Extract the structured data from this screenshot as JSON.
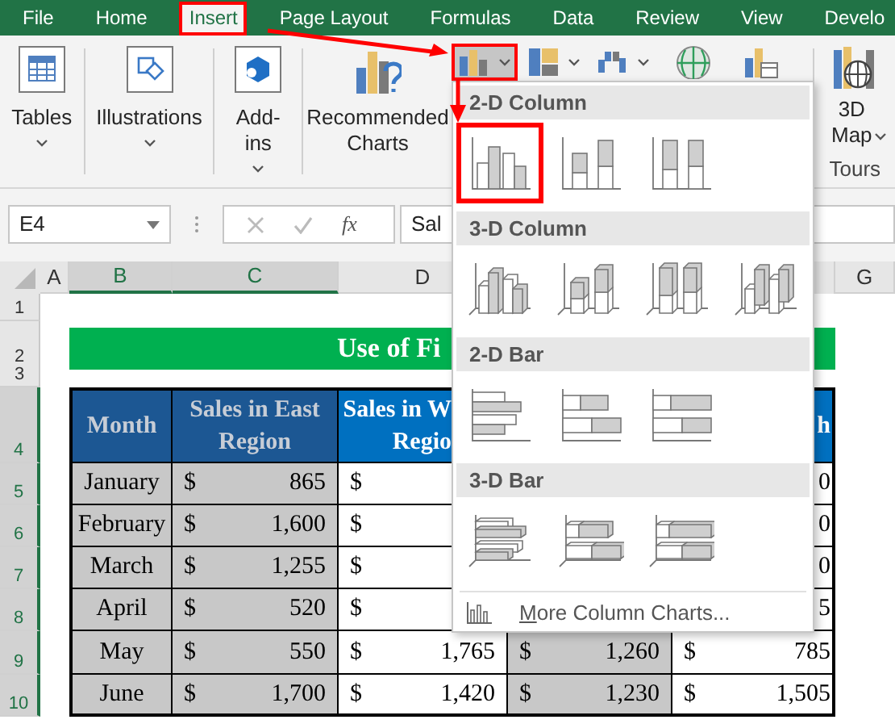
{
  "tabs": [
    {
      "label": "File",
      "selected": false,
      "highlighted": false
    },
    {
      "label": "Home",
      "selected": false,
      "highlighted": false
    },
    {
      "label": "Insert",
      "selected": true,
      "highlighted": true
    },
    {
      "label": "Page Layout",
      "selected": false,
      "highlighted": false
    },
    {
      "label": "Formulas",
      "selected": false,
      "highlighted": false
    },
    {
      "label": "Data",
      "selected": false,
      "highlighted": false
    },
    {
      "label": "Review",
      "selected": false,
      "highlighted": false
    },
    {
      "label": "View",
      "selected": false,
      "highlighted": false
    },
    {
      "label": "Develo",
      "selected": false,
      "highlighted": false
    }
  ],
  "ribbon": {
    "groups": [
      {
        "kind": "tables",
        "label": "Tables",
        "menu": true
      },
      {
        "kind": "illustrations",
        "label": "Illustrations",
        "menu": true
      },
      {
        "kind": "addins",
        "label": "Add-ins",
        "menu": true
      },
      {
        "kind": "recommended",
        "label": "Recommended Charts",
        "menu": false
      }
    ],
    "chart_buttons": [
      {
        "kind": "column",
        "menu": true,
        "highlighted": true
      },
      {
        "kind": "hierarchy",
        "menu": true,
        "highlighted": false
      },
      {
        "kind": "waterfall",
        "menu": true,
        "highlighted": false
      },
      {
        "kind": "map",
        "menu": false,
        "highlighted": false
      },
      {
        "kind": "pivot",
        "menu": false,
        "highlighted": false
      }
    ],
    "tours": {
      "label": "3D Map",
      "menu": true,
      "group_label": "Tours"
    }
  },
  "formula_bar": {
    "name_box": "E4",
    "function_label": "fx",
    "formula": "Sal"
  },
  "column_headers": [
    {
      "label": "A",
      "selected": false
    },
    {
      "label": "B",
      "selected": true
    },
    {
      "label": "C",
      "selected": true
    },
    {
      "label": "D",
      "selected": false
    },
    {
      "label": "G",
      "selected": false
    }
  ],
  "row_headers": [
    {
      "label": "1",
      "selected": false
    },
    {
      "label": "2",
      "selected": false
    },
    {
      "label": "3",
      "selected": false
    },
    {
      "label": "4",
      "selected": true
    },
    {
      "label": "5",
      "selected": true
    },
    {
      "label": "6",
      "selected": true
    },
    {
      "label": "7",
      "selected": true
    },
    {
      "label": "8",
      "selected": true
    },
    {
      "label": "9",
      "selected": true
    },
    {
      "label": "10",
      "selected": true
    }
  ],
  "title": "Use of Fi",
  "table": {
    "columns": [
      {
        "header": "Month",
        "selected": true
      },
      {
        "header": "Sales in East Region",
        "selected": true
      },
      {
        "header_lines": [
          "Sales in W",
          "Regio"
        ],
        "selected": false
      },
      {
        "selected": true
      },
      {
        "header": "h",
        "selected": false
      }
    ],
    "rows": [
      {
        "cells": [
          {
            "text": "January"
          },
          {
            "currency": "$",
            "amount": "865"
          },
          {
            "currency": "$"
          },
          null,
          {
            "amount": "0"
          }
        ]
      },
      {
        "cells": [
          {
            "text": "February"
          },
          {
            "currency": "$",
            "amount": "1,600"
          },
          {
            "currency": "$"
          },
          null,
          {
            "amount": "0"
          }
        ]
      },
      {
        "cells": [
          {
            "text": "March"
          },
          {
            "currency": "$",
            "amount": "1,255"
          },
          {
            "currency": "$"
          },
          null,
          {
            "amount": "0"
          }
        ]
      },
      {
        "cells": [
          {
            "text": "April"
          },
          {
            "currency": "$",
            "amount": "520"
          },
          {
            "currency": "$"
          },
          null,
          {
            "amount": "5"
          }
        ]
      },
      {
        "cells": [
          {
            "text": "May"
          },
          {
            "currency": "$",
            "amount": "550"
          },
          {
            "currency": "$",
            "amount": "1,765"
          },
          {
            "currency": "$",
            "amount": "1,260"
          },
          {
            "currency": "$",
            "amount": "785"
          }
        ]
      },
      {
        "cells": [
          {
            "text": "June"
          },
          {
            "currency": "$",
            "amount": "1,700"
          },
          {
            "currency": "$",
            "amount": "1,420"
          },
          {
            "currency": "$",
            "amount": "1,230"
          },
          {
            "currency": "$",
            "amount": "1,505"
          }
        ]
      }
    ]
  },
  "chart_menu": {
    "sections": [
      {
        "title": "2-D Column",
        "kind": "column2d",
        "options": [
          {
            "kind": "clustered",
            "selected": true
          },
          {
            "kind": "stacked",
            "selected": false
          },
          {
            "kind": "stacked100",
            "selected": false
          }
        ]
      },
      {
        "title": "3-D Column",
        "kind": "column3d",
        "options": [
          {
            "kind": "clustered",
            "selected": false
          },
          {
            "kind": "stacked",
            "selected": false
          },
          {
            "kind": "stacked100",
            "selected": false
          },
          {
            "kind": "column3d",
            "selected": false
          }
        ]
      },
      {
        "title": "2-D Bar",
        "kind": "bar2d",
        "options": [
          {
            "kind": "clustered",
            "selected": false
          },
          {
            "kind": "stacked",
            "selected": false
          },
          {
            "kind": "stacked100",
            "selected": false
          }
        ]
      },
      {
        "title": "3-D Bar",
        "kind": "bar3d",
        "options": [
          {
            "kind": "clustered",
            "selected": false
          },
          {
            "kind": "stacked",
            "selected": false
          },
          {
            "kind": "stacked100",
            "selected": false
          }
        ]
      }
    ],
    "footer": "More Column Charts..."
  }
}
